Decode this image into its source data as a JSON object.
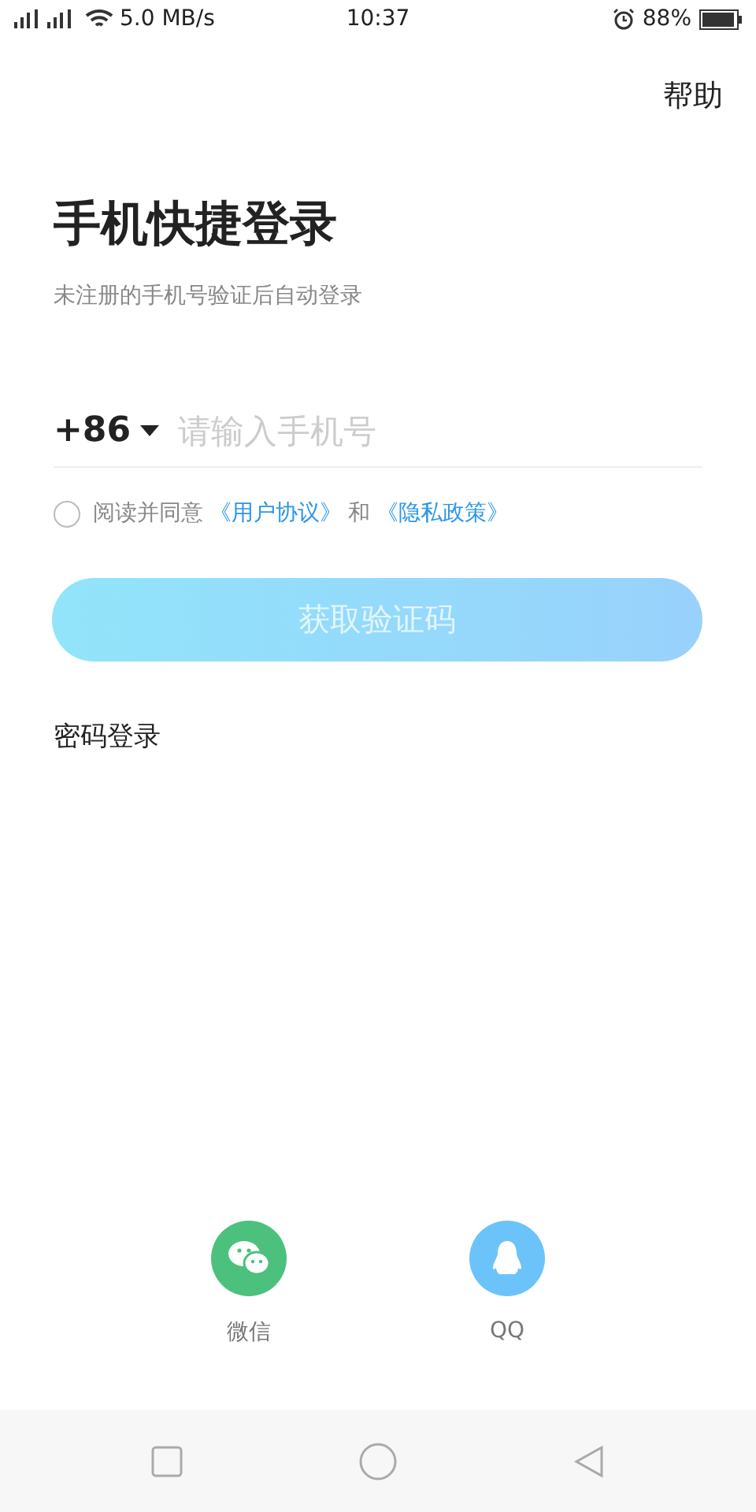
{
  "status_bar": {
    "network_speed": "5.0 MB/s",
    "time": "10:37",
    "battery": "88%"
  },
  "help": "帮助",
  "title": "手机快捷登录",
  "subtitle": "未注册的手机号验证后自动登录",
  "phone": {
    "country_code": "+86",
    "placeholder": "请输入手机号"
  },
  "agreement": {
    "checked": false,
    "parts": [
      {
        "kind": "text",
        "text": "阅读并同意"
      },
      {
        "kind": "link",
        "text": "《用户协议》"
      },
      {
        "kind": "text",
        "text": "和"
      },
      {
        "kind": "link",
        "text": "《隐私政策》"
      }
    ]
  },
  "submit": {
    "label": "获取验证码",
    "disabled": true
  },
  "password_login": "密码登录",
  "social": [
    {
      "kind": "wechat",
      "label": "微信"
    },
    {
      "kind": "qq",
      "label": "QQ"
    }
  ]
}
